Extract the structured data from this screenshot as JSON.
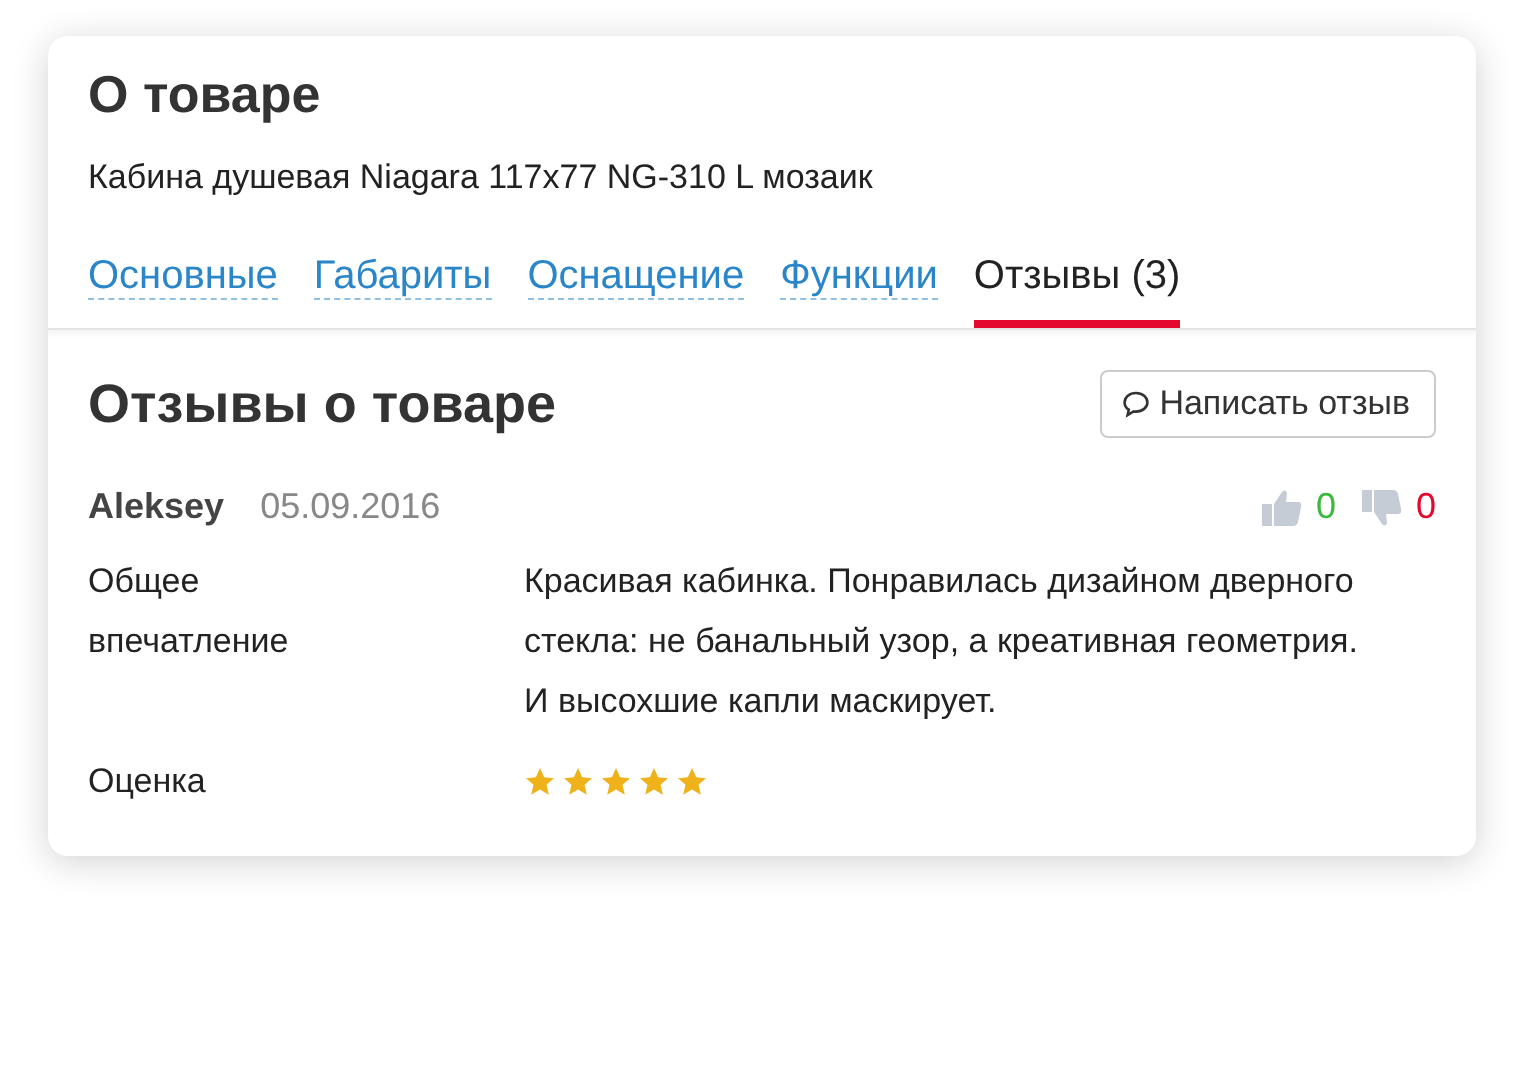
{
  "header": {
    "title": "О товаре",
    "product": "Кабина душевая Niagara 117x77 NG-310 L мозаик"
  },
  "tabs": [
    {
      "label": "Основные",
      "selected": false
    },
    {
      "label": "Габариты",
      "selected": false
    },
    {
      "label": "Оснащение",
      "selected": false
    },
    {
      "label": "Функции",
      "selected": false
    },
    {
      "label": "Отзывы (3)",
      "selected": true
    }
  ],
  "reviews_section": {
    "title": "Отзывы о товаре",
    "write_button": "Написать отзыв"
  },
  "review": {
    "author": "Aleksey",
    "date": "05.09.2016",
    "likes": "0",
    "dislikes": "0",
    "fields": [
      {
        "kind": "text",
        "label": "Общее впечатление",
        "value": "Красивая кабинка. Понравилась дизайном дверного стекла: не банальный узор, а креативная геометрия. И высохшие капли маскирует."
      },
      {
        "kind": "rating",
        "label": "Оценка",
        "stars": 5
      }
    ]
  }
}
